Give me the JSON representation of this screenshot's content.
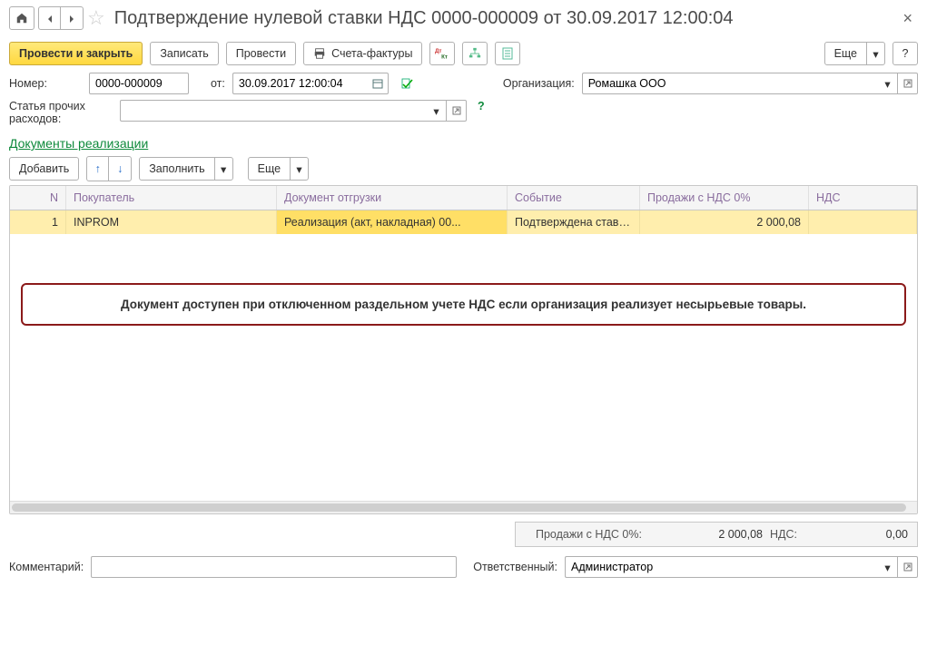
{
  "title": "Подтверждение нулевой ставки НДС 0000-000009 от 30.09.2017 12:00:04",
  "toolbar": {
    "post_close": "Провести и закрыть",
    "save": "Записать",
    "post": "Провести",
    "invoices": "Счета-фактуры",
    "more": "Еще",
    "help": "?"
  },
  "fields": {
    "number_label": "Номер:",
    "number_value": "0000-000009",
    "date_label": "от:",
    "date_value": "30.09.2017 12:00:04",
    "org_label": "Организация:",
    "org_value": "Ромашка ООО",
    "expense_label1": "Статья прочих",
    "expense_label2": "расходов:",
    "expense_value": ""
  },
  "docs_link": "Документы реализации",
  "table_toolbar": {
    "add": "Добавить",
    "fill": "Заполнить",
    "more": "Еще"
  },
  "columns": {
    "n": "N",
    "buyer": "Покупатель",
    "doc": "Документ отгрузки",
    "event": "Событие",
    "sales": "Продажи с НДС 0%",
    "vat": "НДС"
  },
  "rows": [
    {
      "n": "1",
      "buyer": "INPROM",
      "doc": "Реализация (акт, накладная) 00...",
      "event": "Подтверждена ставк...",
      "sales": "2 000,08",
      "vat": ""
    }
  ],
  "callout": "Документ доступен при отключенном раздельном учете НДС если организация реализует несырьевые товары.",
  "totals": {
    "sales_label": "Продажи с НДС 0%:",
    "sales_value": "2 000,08",
    "vat_label": "НДС:",
    "vat_value": "0,00"
  },
  "footer": {
    "comment_label": "Комментарий:",
    "comment_value": "",
    "responsible_label": "Ответственный:",
    "responsible_value": "Администратор"
  }
}
